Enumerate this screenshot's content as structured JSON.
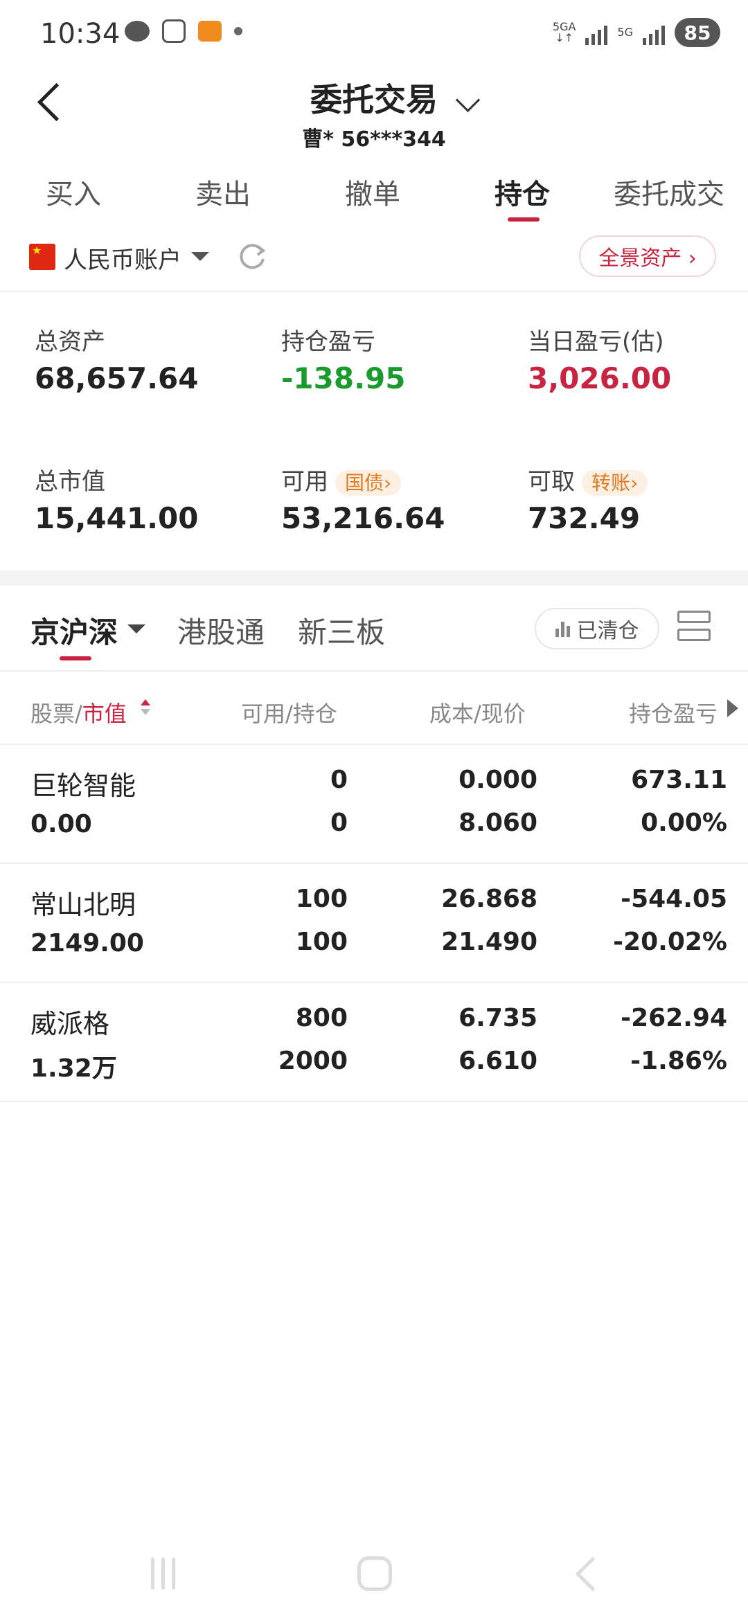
{
  "status_bar": {
    "time": "10:34",
    "left_icons": [
      "wechat-icon",
      "screenshot-icon",
      "app-orange-icon",
      "dot-icon"
    ],
    "net1": "5GA",
    "net2": "5G",
    "battery": "85"
  },
  "header": {
    "title": "委托交易",
    "account": "曹* 56***344"
  },
  "tabs": [
    {
      "label": "买入"
    },
    {
      "label": "卖出"
    },
    {
      "label": "撤单"
    },
    {
      "label": "持仓",
      "active": true
    },
    {
      "label": "委托成交"
    }
  ],
  "account_row": {
    "flag": "china-flag-icon",
    "label": "人民币账户",
    "full_assets": "全景资产 ›"
  },
  "summary": {
    "total_assets_label": "总资产",
    "total_assets": "68,657.64",
    "position_pl_label": "持仓盈亏",
    "position_pl": "-138.95",
    "daily_pl_label": "当日盈亏(估)",
    "daily_pl": "3,026.00",
    "market_value_label": "总市值",
    "market_value": "15,441.00",
    "available_label": "可用",
    "available_chip": "国债›",
    "available": "53,216.64",
    "withdrawable_label": "可取",
    "withdrawable_chip": "转账›",
    "withdrawable": "732.49"
  },
  "market_tabs": {
    "items": [
      "京沪深",
      "港股通",
      "新三板"
    ],
    "cleared": "已清仓"
  },
  "table": {
    "headers": {
      "stock": "股票/",
      "market_value": "市值",
      "qty": "可用/持仓",
      "price": "成本/现价",
      "pl": "持仓盈亏"
    },
    "rows": [
      {
        "name": "巨轮智能",
        "value": "0.00",
        "avail": "0",
        "hold": "0",
        "cost": "0.000",
        "price": "8.060",
        "pl": "673.11",
        "pl_pct": "0.00%",
        "tone": "red"
      },
      {
        "name": "常山北明",
        "value": "2149.00",
        "avail": "100",
        "hold": "100",
        "cost": "26.868",
        "price": "21.490",
        "pl": "-544.05",
        "pl_pct": "-20.02%",
        "tone": "green"
      },
      {
        "name": "威派格",
        "value": "1.32万",
        "avail": "800",
        "hold": "2000",
        "cost": "6.735",
        "price": "6.610",
        "pl": "-262.94",
        "pl_pct": "-1.86%",
        "tone": "green"
      }
    ]
  },
  "colors": {
    "accent": "#c8243f",
    "loss": "#1a9b2d",
    "chip": "#e07a1f"
  }
}
